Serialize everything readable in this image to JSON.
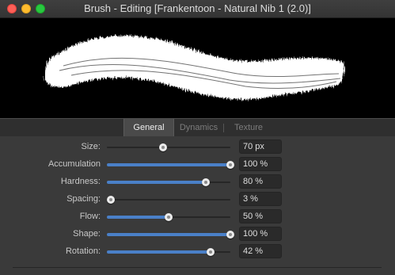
{
  "window": {
    "title": "Brush - Editing [Frankentoon - Natural Nib 1 (2.0)]",
    "traffic_lights": [
      "close",
      "minimize",
      "maximize"
    ]
  },
  "tabs": [
    {
      "label": "General",
      "active": true
    },
    {
      "label": "Dynamics",
      "active": false
    },
    {
      "label": "Texture",
      "active": false
    }
  ],
  "settings": [
    {
      "label": "Size:",
      "value": "70 px",
      "position": 0.455,
      "filled": false
    },
    {
      "label": "Accumulation",
      "value": "100 %",
      "position": 1.0,
      "filled": true
    },
    {
      "label": "Hardness:",
      "value": "80 %",
      "position": 0.8,
      "filled": true
    },
    {
      "label": "Spacing:",
      "value": "3 %",
      "position": 0.03,
      "filled": false
    },
    {
      "label": "Flow:",
      "value": "50 %",
      "position": 0.5,
      "filled": true
    },
    {
      "label": "Shape:",
      "value": "100 %",
      "position": 1.0,
      "filled": true
    },
    {
      "label": "Rotation:",
      "value": "42 %",
      "position": 0.84,
      "filled": true
    }
  ],
  "colors": {
    "accent": "#4a80c8",
    "preview_background": "#000000",
    "stroke": "#ffffff"
  }
}
